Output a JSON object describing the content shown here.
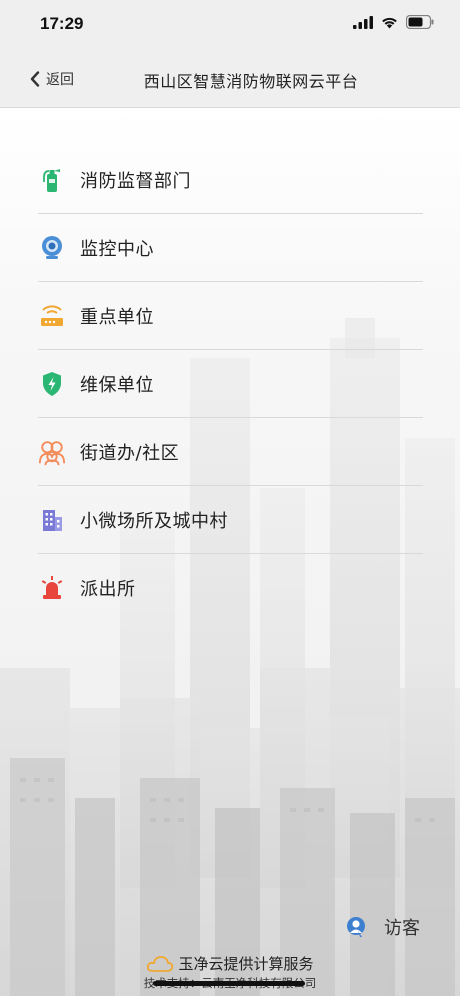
{
  "status_bar": {
    "time": "17:29"
  },
  "nav": {
    "back_label": "返回",
    "title": "西山区智慧消防物联网云平台"
  },
  "menu": {
    "items": [
      {
        "label": "消防监督部门",
        "icon": "fire-extinguisher-icon",
        "color": "#2bb673"
      },
      {
        "label": "监控中心",
        "icon": "webcam-icon",
        "color": "#4a8fd6"
      },
      {
        "label": "重点单位",
        "icon": "router-icon",
        "color": "#f0a832"
      },
      {
        "label": "维保单位",
        "icon": "shield-icon",
        "color": "#2bb673"
      },
      {
        "label": "街道办/社区",
        "icon": "community-icon",
        "color": "#f28c5a"
      },
      {
        "label": "小微场所及城中村",
        "icon": "building-icon",
        "color": "#7a7ad6"
      },
      {
        "label": "派出所",
        "icon": "police-siren-icon",
        "color": "#e8453c"
      }
    ]
  },
  "visitor": {
    "label": "访客"
  },
  "footer": {
    "main": "玉净云提供计算服务",
    "sub": "技术支持：云南玉净科技有限公司"
  }
}
